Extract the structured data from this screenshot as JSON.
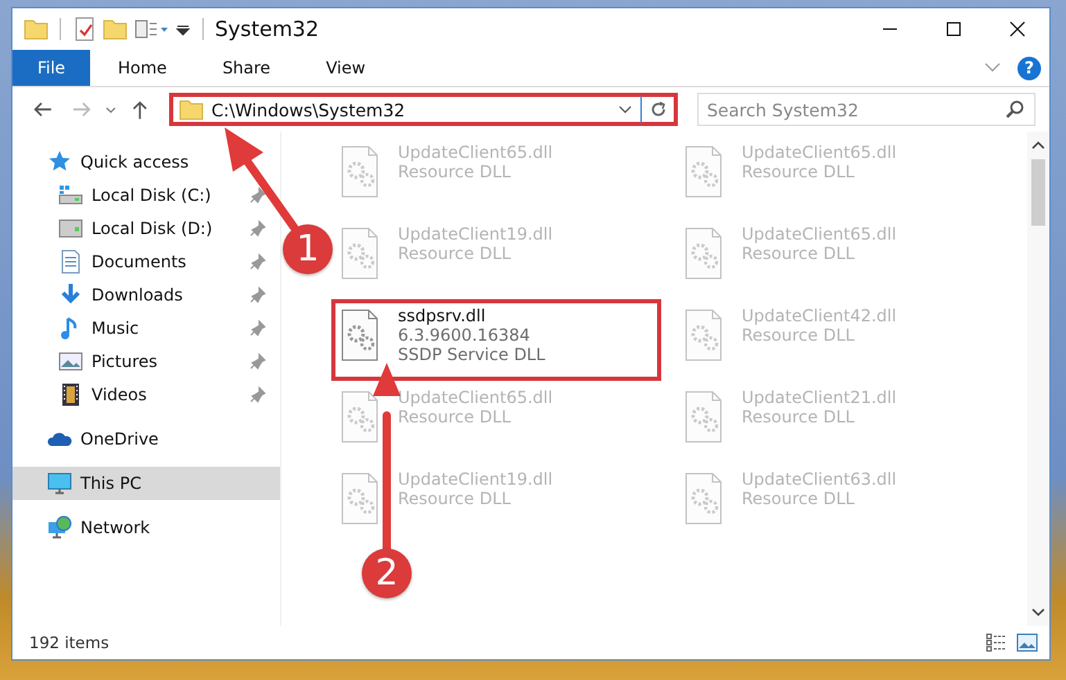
{
  "window": {
    "title": "System32"
  },
  "ribbon_tabs": [
    {
      "label": "File",
      "kind": "file"
    },
    {
      "label": "Home",
      "kind": "tab"
    },
    {
      "label": "Share",
      "kind": "tab"
    },
    {
      "label": "View",
      "kind": "tab"
    }
  ],
  "address_bar": {
    "path": "C:\\Windows\\System32",
    "highlighted": true
  },
  "help_button": "?",
  "search": {
    "placeholder": "Search System32"
  },
  "sidebar": {
    "items": [
      {
        "label": "Quick access",
        "kind": "star",
        "selected": false,
        "children": [
          {
            "label": "Local Disk (C:)",
            "kind": "drive-c",
            "pinned": true,
            "selected": false
          },
          {
            "label": "Local Disk (D:)",
            "kind": "drive",
            "pinned": true,
            "selected": false
          },
          {
            "label": "Documents",
            "kind": "document",
            "pinned": true,
            "selected": false
          },
          {
            "label": "Downloads",
            "kind": "download",
            "pinned": true,
            "selected": false
          },
          {
            "label": "Music",
            "kind": "music",
            "pinned": true,
            "selected": false
          },
          {
            "label": "Pictures",
            "kind": "picture",
            "pinned": true,
            "selected": false
          },
          {
            "label": "Videos",
            "kind": "video",
            "pinned": true,
            "selected": false
          }
        ]
      },
      {
        "label": "OneDrive",
        "kind": "cloud",
        "selected": false
      },
      {
        "label": "This PC",
        "kind": "computer",
        "selected": true
      },
      {
        "label": "Network",
        "kind": "network",
        "selected": false
      }
    ]
  },
  "files": [
    {
      "name": "UpdateClient65.dll",
      "details": [
        "Resource DLL"
      ],
      "dimmed": true,
      "highlighted": false
    },
    {
      "name": "UpdateClient65.dll",
      "details": [
        "Resource DLL"
      ],
      "dimmed": true,
      "highlighted": false
    },
    {
      "name": "UpdateClient19.dll",
      "details": [
        "Resource DLL"
      ],
      "dimmed": true,
      "highlighted": false
    },
    {
      "name": "UpdateClient65.dll",
      "details": [
        "Resource DLL"
      ],
      "dimmed": true,
      "highlighted": false
    },
    {
      "name": "ssdpsrv.dll",
      "details": [
        "6.3.9600.16384",
        "SSDP Service DLL"
      ],
      "dimmed": false,
      "highlighted": true
    },
    {
      "name": "UpdateClient42.dll",
      "details": [
        "Resource DLL"
      ],
      "dimmed": true,
      "highlighted": false
    },
    {
      "name": "UpdateClient65.dll",
      "details": [
        "Resource DLL"
      ],
      "dimmed": true,
      "highlighted": false
    },
    {
      "name": "UpdateClient21.dll",
      "details": [
        "Resource DLL"
      ],
      "dimmed": true,
      "highlighted": false
    },
    {
      "name": "UpdateClient19.dll",
      "details": [
        "Resource DLL"
      ],
      "dimmed": true,
      "highlighted": false
    },
    {
      "name": "UpdateClient63.dll",
      "details": [
        "Resource DLL"
      ],
      "dimmed": true,
      "highlighted": false
    }
  ],
  "status_bar": {
    "item_count": "192 items"
  },
  "callouts": [
    {
      "label": "1"
    },
    {
      "label": "2"
    }
  ]
}
